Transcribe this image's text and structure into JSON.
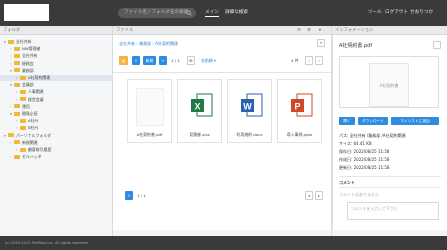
{
  "header": {
    "search_placeholder": "ファイル名 / フォルダ名の検索",
    "nav_main": "メイン",
    "nav_advanced": "詳細な検索",
    "nav_tools": "ツール",
    "nav_logout": "ログアウト",
    "nav_user": "せおりつか"
  },
  "panels": {
    "folder_title": "フォルダ",
    "file_title": "ファイル",
    "info_title": "インフォメーション"
  },
  "tree": [
    {
      "label": "全社共有",
      "chev": "▾",
      "level": 0
    },
    {
      "label": "NW管理者",
      "chev": "›",
      "level": 1
    },
    {
      "label": "全社共有",
      "chev": "›",
      "level": 1
    },
    {
      "label": "総務会",
      "chev": "›",
      "level": 1
    },
    {
      "label": "業務部",
      "chev": "▾",
      "level": 1
    },
    {
      "label": "A社契約関連",
      "chev": "›",
      "level": 2
    },
    {
      "label": "会議部",
      "chev": "▾",
      "level": 1
    },
    {
      "label": "人事関連",
      "chev": "›",
      "level": 2
    },
    {
      "label": "経営会議",
      "chev": "›",
      "level": 2
    },
    {
      "label": "運用",
      "chev": "›",
      "level": 1
    },
    {
      "label": "開発企画",
      "chev": "▾",
      "level": 1
    },
    {
      "label": "A社PJ",
      "chev": "›",
      "level": 2
    },
    {
      "label": "B社PJ",
      "chev": "›",
      "level": 2
    },
    {
      "label": "パーソナルフォルダ",
      "chev": "▾",
      "level": 0
    },
    {
      "label": "新規関連",
      "chev": "›",
      "level": 1
    },
    {
      "label": "顧客取引履歴",
      "chev": "›",
      "level": 2
    },
    {
      "label": "セルハッタ",
      "chev": "›",
      "level": 1
    }
  ],
  "files": {
    "breadcrumb": "全社共有 › 業務部 › A社契約関連",
    "page_indicator": "1 / 1",
    "sort_label": "名前順 ▾",
    "count_label": "4 件",
    "new_label": "新規",
    "items": [
      {
        "name": "A社契約書.pdf",
        "type": "pdf",
        "badge": ""
      },
      {
        "name": "見積書.xlsx",
        "type": "xlsx",
        "badge": "X"
      },
      {
        "name": "利用規約.docx",
        "type": "docx",
        "badge": "W"
      },
      {
        "name": "導入事例.pptx",
        "type": "pptx",
        "badge": "P"
      }
    ],
    "pager_current": "1 / 1",
    "pager_first": "◂",
    "pager_last": "▸"
  },
  "info": {
    "filename": "A社契約書.pdf",
    "preview_text": "A社契約書",
    "btn_open": "開く",
    "btn_download": "ダウンロード",
    "btn_favorite": "マイリストに追加",
    "path": "パス: 全社共有 /業務部 /A社契約関連",
    "size": "サイズ: 64.41 KB",
    "saved": "保存日: 2022/08/25 11:58",
    "created": "作成日: 2022/08/25 11:58",
    "updated": "更新日: 2022/08/25 11:58",
    "comment_heading": "コメント",
    "comment_empty": "コメントはありません",
    "comment_placeholder": "コメントを入力して下さい"
  },
  "footer": {
    "copyright": "(c) 2020-2022 FileMost Inc. All rights reserved."
  },
  "colors": {
    "accent_blue": "#2d8ce0",
    "accent_orange": "#f2b544",
    "header_bg": "#3a3a3a",
    "excel_green": "#1f7a44",
    "word_blue": "#2b5fb3",
    "ppt_orange": "#d24726"
  }
}
